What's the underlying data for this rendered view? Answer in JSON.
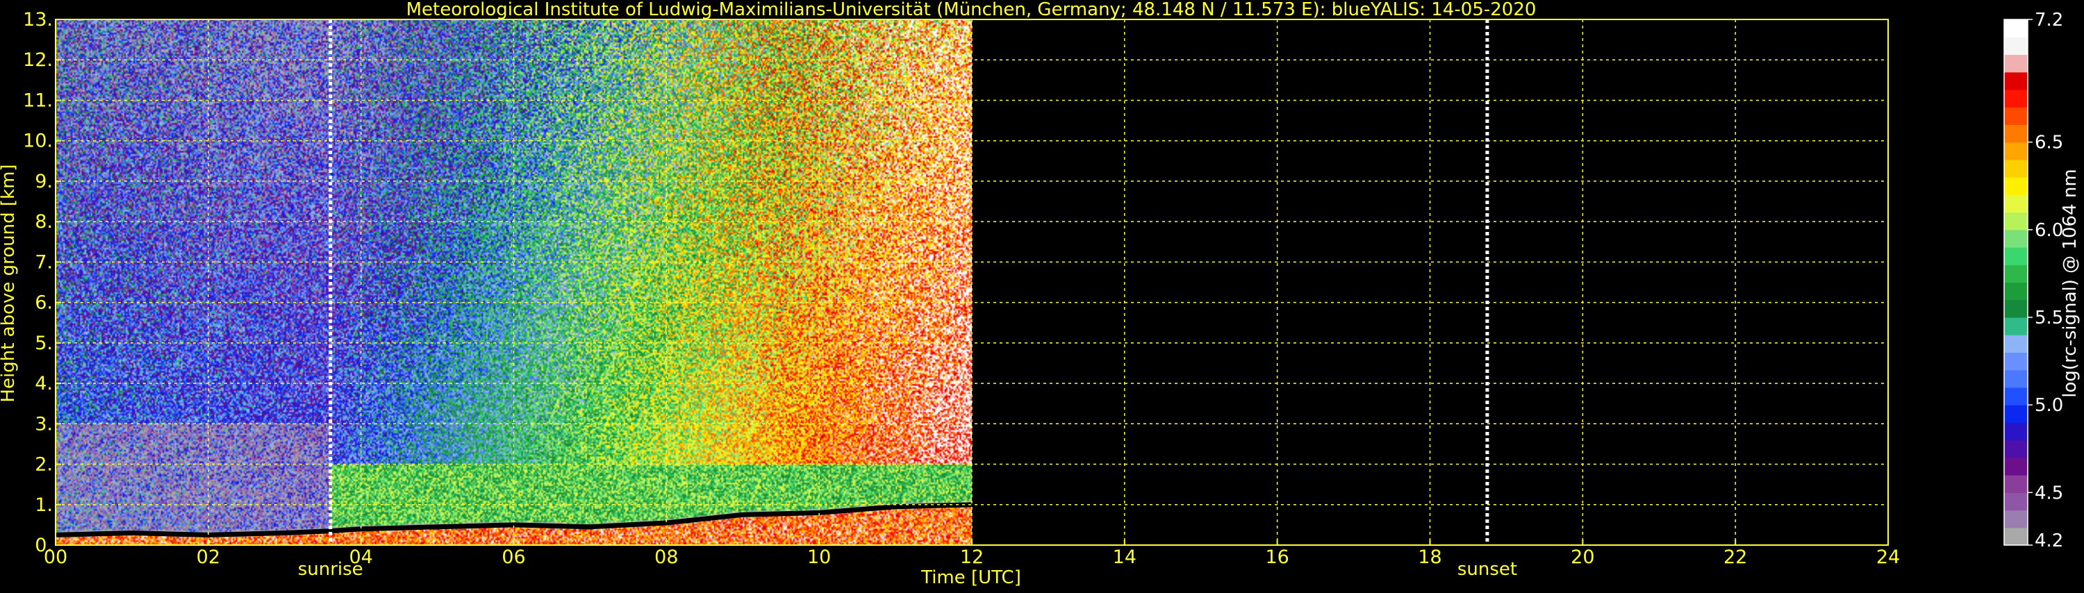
{
  "chart_data": {
    "type": "heatmap",
    "title": "Meteorological Institute of Ludwig-Maximilians-Universität (München, Germany; 48.148 N / 11.573 E):    blueYALIS: 14-05-2020",
    "xlabel": "Time [UTC]",
    "ylabel": "Height above ground [km]",
    "colorbar_label": "log(rc-signal) @ 1064 nm",
    "xlim": [
      0,
      24
    ],
    "ylim": [
      0,
      13
    ],
    "x_ticks": [
      0,
      2,
      4,
      6,
      8,
      10,
      12,
      14,
      16,
      18,
      20,
      22,
      24
    ],
    "x_tick_labels": [
      "00",
      "02",
      "04",
      "06",
      "08",
      "10",
      "12",
      "14",
      "16",
      "18",
      "20",
      "22",
      "24"
    ],
    "y_ticks": [
      0,
      1,
      2,
      3,
      4,
      5,
      6,
      7,
      8,
      9,
      10,
      11,
      12,
      13
    ],
    "y_tick_labels": [
      "0.",
      "1.",
      "2.",
      "3.",
      "4.",
      "5.",
      "6.",
      "7.",
      "8.",
      "9.",
      "10.",
      "11.",
      "12.",
      "13."
    ],
    "grid": true,
    "data_extent_hours": [
      0,
      12
    ],
    "colorbar_range": [
      4.2,
      7.2
    ],
    "colorbar_ticks": [
      4.2,
      4.5,
      5.0,
      5.5,
      6.0,
      6.5,
      7.2
    ],
    "colorbar_tick_labels": [
      "4.2",
      "4.5",
      "5.0",
      "5.5",
      "6.0",
      "6.5",
      "7.2"
    ],
    "colormap": [
      "#a9a9a9",
      "#9b7eb0",
      "#8f56a8",
      "#8a3d9a",
      "#6c0f8a",
      "#4d10a8",
      "#2a14c8",
      "#0a28f0",
      "#2050ff",
      "#4a78ff",
      "#6a90ff",
      "#8fb4f5",
      "#2fbc8a",
      "#168a3c",
      "#1d9c3a",
      "#2fb84a",
      "#3ad66e",
      "#7ae07a",
      "#b8f25a",
      "#e6f840",
      "#fff000",
      "#ffd000",
      "#ffa500",
      "#ff7a00",
      "#ff4a00",
      "#ff1400",
      "#e00000",
      "#f0b0b0",
      "#f5f5f5",
      "#ffffff"
    ],
    "annotations": [
      {
        "label": "sunrise",
        "x": 3.6
      },
      {
        "label": "sunset",
        "x": 18.75
      }
    ],
    "boundary_layer_top_km": [
      [
        0,
        0.25
      ],
      [
        1,
        0.3
      ],
      [
        2,
        0.25
      ],
      [
        3,
        0.3
      ],
      [
        3.6,
        0.35
      ],
      [
        4,
        0.4
      ],
      [
        5,
        0.45
      ],
      [
        6,
        0.5
      ],
      [
        7,
        0.45
      ],
      [
        7.5,
        0.5
      ],
      [
        8,
        0.55
      ],
      [
        9,
        0.75
      ],
      [
        10,
        0.8
      ],
      [
        11,
        0.95
      ],
      [
        12,
        1.0
      ]
    ],
    "colors": {
      "text": "#ffff33",
      "grid": "#ffff33",
      "background": "#000000",
      "marker_line": "#ffffff"
    }
  }
}
